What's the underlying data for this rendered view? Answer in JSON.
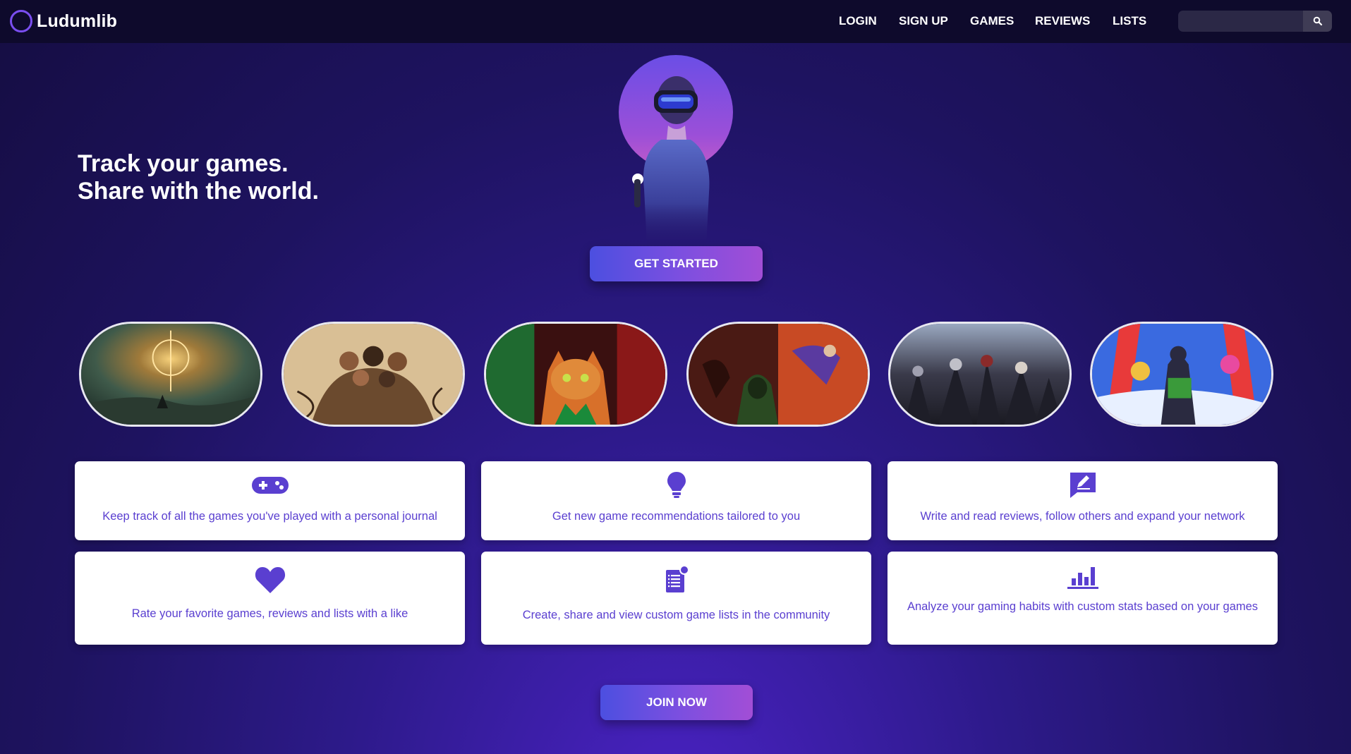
{
  "app": {
    "name": "Ludumlib"
  },
  "nav": {
    "links": [
      {
        "label": "LOGIN"
      },
      {
        "label": "SIGN UP"
      },
      {
        "label": "GAMES"
      },
      {
        "label": "REVIEWS"
      },
      {
        "label": "LISTS"
      }
    ],
    "search": {
      "value": "",
      "placeholder": "",
      "icon": "search-icon"
    }
  },
  "hero": {
    "line1": "Track your games.",
    "line2": "Share with the world.",
    "cta": "GET STARTED"
  },
  "games": [
    {
      "icon": "game-cover-1"
    },
    {
      "icon": "game-cover-2"
    },
    {
      "icon": "game-cover-3"
    },
    {
      "icon": "game-cover-4"
    },
    {
      "icon": "game-cover-5"
    },
    {
      "icon": "game-cover-6"
    }
  ],
  "features": [
    {
      "icon": "gamepad-icon",
      "text": "Keep track of all the games you've played with a personal journal"
    },
    {
      "icon": "lightbulb-icon",
      "text": "Get new game recommendations tailored to you"
    },
    {
      "icon": "review-edit-icon",
      "text": "Write and read reviews, follow others and expand your network"
    },
    {
      "icon": "heart-icon",
      "text": "Rate your favorite games, reviews and lists with a like"
    },
    {
      "icon": "list-icon",
      "text": "Create, share and view custom game lists in the community"
    },
    {
      "icon": "bar-chart-icon",
      "text": "Analyze your gaming habits with custom stats based on your games"
    }
  ],
  "footer_cta": "JOIN NOW",
  "colors": {
    "accent": "#5a3fd0",
    "nav_bg": "#0e0a2c",
    "cta_start": "#4c4fe0",
    "cta_end": "#a24ed6"
  }
}
